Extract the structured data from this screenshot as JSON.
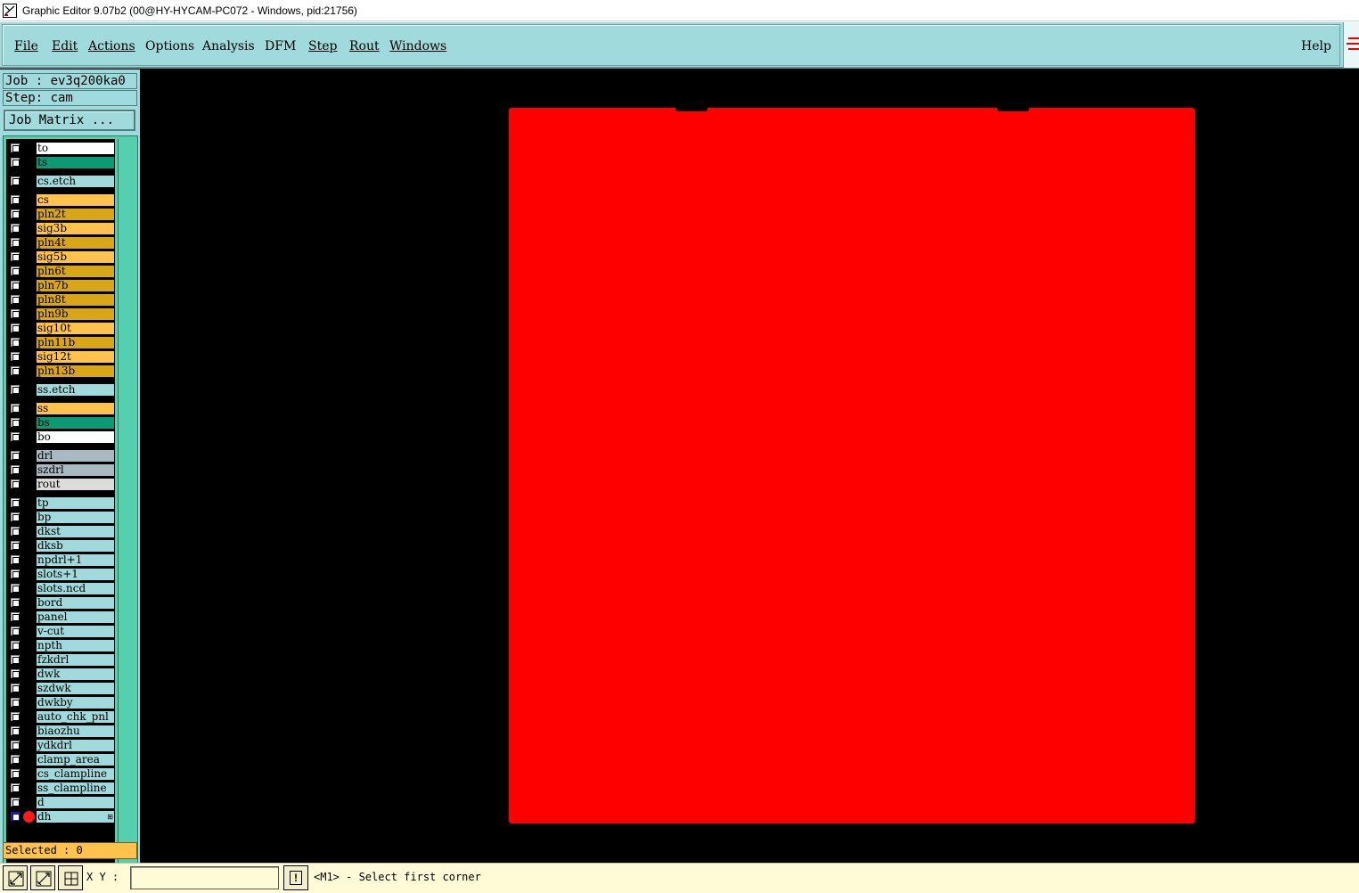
{
  "window": {
    "title": "Graphic Editor 9.07b2 (00@HY-HYCAM-PC072 - Windows, pid:21756)"
  },
  "menu": {
    "items": [
      "File",
      "Edit",
      "Actions",
      "Options",
      "Analysis",
      "DFM",
      "Step",
      "Rout",
      "Windows"
    ],
    "help": "Help"
  },
  "job": {
    "job_line": "Job : ev3q200ka0",
    "step_line": "Step: cam",
    "matrix_button": "Job Matrix ..."
  },
  "layers": [
    {
      "name": "to",
      "color": "#ffffff"
    },
    {
      "name": "ts",
      "color": "#0c9a74"
    },
    {
      "name": "cs.etch",
      "color": "#a0dadc"
    },
    {
      "name": "cs",
      "color": "#ffc34d"
    },
    {
      "name": "pln2t",
      "color": "#d8a616"
    },
    {
      "name": "sig3b",
      "color": "#ffc34d"
    },
    {
      "name": "pln4t",
      "color": "#d8a616"
    },
    {
      "name": "sig5b",
      "color": "#ffc34d"
    },
    {
      "name": "pln6t",
      "color": "#d8a616"
    },
    {
      "name": "pln7b",
      "color": "#d8a616"
    },
    {
      "name": "pln8t",
      "color": "#d8a616"
    },
    {
      "name": "pln9b",
      "color": "#d8a616"
    },
    {
      "name": "sig10t",
      "color": "#ffc34d"
    },
    {
      "name": "pln11b",
      "color": "#d8a616"
    },
    {
      "name": "sig12t",
      "color": "#ffc34d"
    },
    {
      "name": "pln13b",
      "color": "#d8a616"
    },
    {
      "name": "ss.etch",
      "color": "#a0dadc"
    },
    {
      "name": "ss",
      "color": "#ffc34d"
    },
    {
      "name": "bs",
      "color": "#0c9a74"
    },
    {
      "name": "bo",
      "color": "#ffffff"
    },
    {
      "name": "drl",
      "color": "#a9b9c2"
    },
    {
      "name": "szdrl",
      "color": "#a9b9c2"
    },
    {
      "name": "rout",
      "color": "#dcdcdc"
    },
    {
      "name": "tp",
      "color": "#a0dadc"
    },
    {
      "name": "bp",
      "color": "#a0dadc"
    },
    {
      "name": "dkst",
      "color": "#a0dadc"
    },
    {
      "name": "dksb",
      "color": "#a0dadc"
    },
    {
      "name": "npdrl+1",
      "color": "#a0dadc"
    },
    {
      "name": "slots+1",
      "color": "#a0dadc"
    },
    {
      "name": "slots.ncd",
      "color": "#a0dadc"
    },
    {
      "name": "bord",
      "color": "#a0dadc"
    },
    {
      "name": "panel",
      "color": "#a0dadc"
    },
    {
      "name": "v-cut",
      "color": "#a0dadc"
    },
    {
      "name": "npth",
      "color": "#a0dadc"
    },
    {
      "name": "fzkdrl",
      "color": "#a0dadc"
    },
    {
      "name": "dwk",
      "color": "#a0dadc"
    },
    {
      "name": "szdwk",
      "color": "#a0dadc"
    },
    {
      "name": "dwkby",
      "color": "#a0dadc"
    },
    {
      "name": "auto_chk_pnl",
      "color": "#a0dadc"
    },
    {
      "name": "biaozhu",
      "color": "#a0dadc"
    },
    {
      "name": "ydkdrl",
      "color": "#a0dadc"
    },
    {
      "name": "clamp_area",
      "color": "#a0dadc"
    },
    {
      "name": "cs_clampline",
      "color": "#a0dadc"
    },
    {
      "name": "ss_clampline",
      "color": "#a0dadc"
    },
    {
      "name": "d",
      "color": "#a0dadc"
    },
    {
      "name": "dh",
      "color": "#a0dadc",
      "active": true
    }
  ],
  "status": {
    "selected": "Selected : 0"
  },
  "bottom": {
    "xy_label": "X Y :",
    "xy_value": "",
    "prompt": "<M1> - Select first corner"
  },
  "colors": {
    "board": "#ff0000",
    "panel_bg": "#a0dadc",
    "canvas_bg": "#000000"
  },
  "icons": [
    "app-icon",
    "zoom-fit-icon",
    "zoom-area-icon",
    "grid-snap-icon",
    "warning-icon"
  ]
}
